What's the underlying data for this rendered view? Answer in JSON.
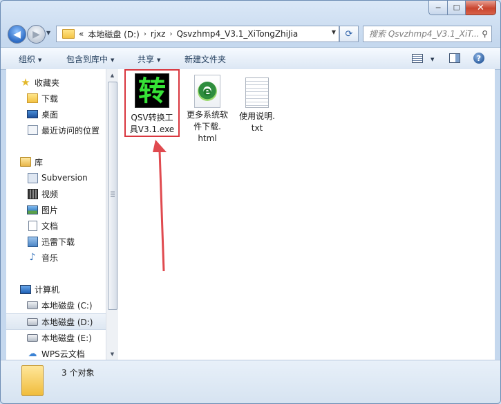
{
  "window": {
    "controls": {
      "minimize": "─",
      "maximize": "☐",
      "close": "✕"
    }
  },
  "nav": {
    "back_glyph": "◀",
    "forward_glyph": "▶",
    "breadcrumbs": [
      "«",
      "本地磁盘 (D:)",
      "rjxz",
      "Qsvzhmp4_V3.1_XiTongZhiJia"
    ],
    "separator": "›",
    "search_placeholder": "搜索 Qsvzhmp4_V3.1_XiT...",
    "refresh_glyph": "⟳"
  },
  "toolbar": {
    "organize": "组织",
    "include_in_library": "包含到库中",
    "share": "共享",
    "new_folder": "新建文件夹",
    "help": "?"
  },
  "sidebar": {
    "favorites": {
      "header": "收藏夹",
      "items": [
        "下载",
        "桌面",
        "最近访问的位置"
      ]
    },
    "libraries": {
      "header": "库",
      "items": [
        "Subversion",
        "视频",
        "图片",
        "文档",
        "迅雷下载",
        "音乐"
      ]
    },
    "computer": {
      "header": "计算机",
      "items": [
        "本地磁盘 (C:)",
        "本地磁盘 (D:)",
        "本地磁盘 (E:)",
        "WPS云文档"
      ],
      "selected": "本地磁盘 (D:)"
    }
  },
  "files": [
    {
      "line1": "QSV转换工",
      "line2": "具V3.1.exe",
      "line3": "",
      "icon_text": "转",
      "type": "exe"
    },
    {
      "line1": "更多系统软",
      "line2": "件下载.",
      "line3": "html",
      "icon_text": "e",
      "type": "html"
    },
    {
      "line1": "使用说明.",
      "line2": "txt",
      "line3": "",
      "icon_text": "",
      "type": "txt"
    }
  ],
  "status": {
    "count": "3 个对象"
  },
  "colors": {
    "highlight_box": "#d9363e",
    "arrow": "#e04a4f",
    "accent": "#2d6bc4"
  }
}
